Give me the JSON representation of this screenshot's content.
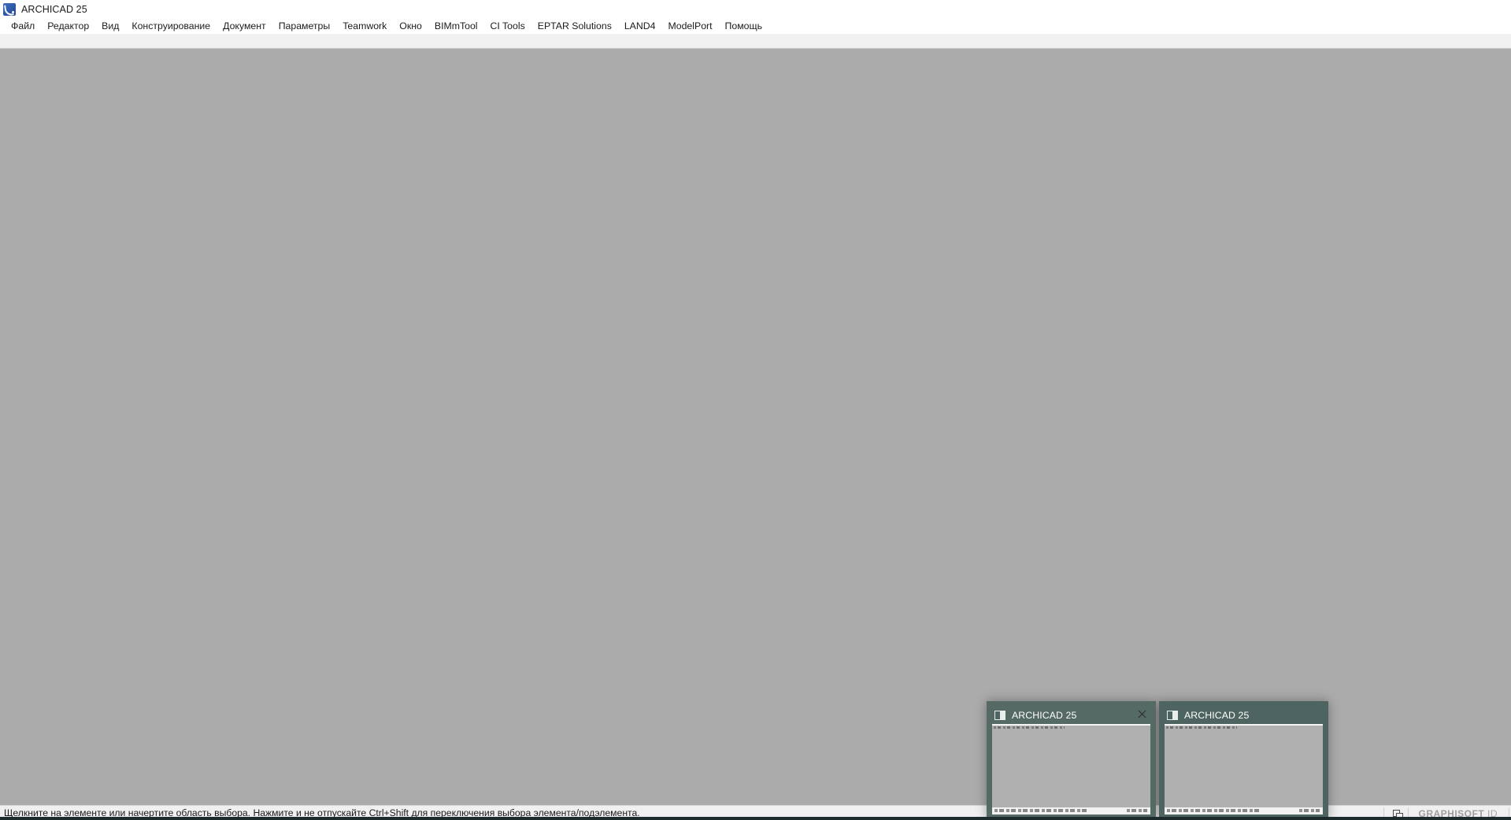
{
  "window": {
    "title": "ARCHICAD 25",
    "app_icon": "archicad-logo-icon"
  },
  "menubar": {
    "items": [
      {
        "label": "Файл"
      },
      {
        "label": "Редактор"
      },
      {
        "label": "Вид"
      },
      {
        "label": "Конструирование"
      },
      {
        "label": "Документ"
      },
      {
        "label": "Параметры"
      },
      {
        "label": "Teamwork"
      },
      {
        "label": "Окно"
      },
      {
        "label": "BIMmTool"
      },
      {
        "label": "CI Tools"
      },
      {
        "label": "EPTAR Solutions"
      },
      {
        "label": "LAND4"
      },
      {
        "label": "ModelPort"
      },
      {
        "label": "Помощь"
      }
    ]
  },
  "statusbar": {
    "message": "Щелкните на элементе или начертите область выбора. Нажмите и не отпускайте Ctrl+Shift для переключения выбора элемента/подэлемента.",
    "restore_icon": "restore-window-icon",
    "graphisoft_id_bold": "GRAPHISOFT",
    "graphisoft_id_light": "ID"
  },
  "taskbar_previews": {
    "items": [
      {
        "title": "ARCHICAD 25",
        "icon": "window-preview-icon",
        "close_icon": "close-icon",
        "hovered": true,
        "has_close": true
      },
      {
        "title": "ARCHICAD 25",
        "icon": "window-preview-icon",
        "close_icon": "close-icon",
        "hovered": false,
        "has_close": false
      }
    ]
  },
  "colors": {
    "canvas": "#ababab",
    "chrome": "#f0f0f0",
    "preview_panel": "#4e6460",
    "taskbar": "#1d2b2c",
    "accent": "#2f58a8"
  }
}
